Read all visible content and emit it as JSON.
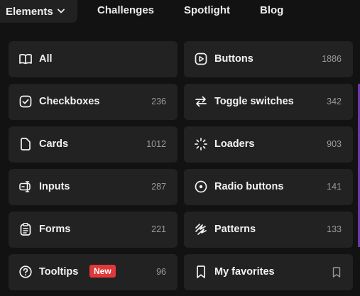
{
  "nav": {
    "elements_label": "Elements",
    "challenges_label": "Challenges",
    "spotlight_label": "Spotlight",
    "blog_label": "Blog"
  },
  "categories": [
    {
      "label": "All",
      "count": "",
      "icon": "book-open-icon"
    },
    {
      "label": "Buttons",
      "count": "1886",
      "icon": "play-button-icon"
    },
    {
      "label": "Checkboxes",
      "count": "236",
      "icon": "checkbox-icon"
    },
    {
      "label": "Toggle switches",
      "count": "342",
      "icon": "arrows-swap-icon"
    },
    {
      "label": "Cards",
      "count": "1012",
      "icon": "card-file-icon"
    },
    {
      "label": "Loaders",
      "count": "903",
      "icon": "loader-icon"
    },
    {
      "label": "Inputs",
      "count": "287",
      "icon": "input-icon"
    },
    {
      "label": "Radio buttons",
      "count": "141",
      "icon": "radio-icon"
    },
    {
      "label": "Forms",
      "count": "221",
      "icon": "clipboard-form-icon"
    },
    {
      "label": "Patterns",
      "count": "133",
      "icon": "pattern-icon"
    },
    {
      "label": "Tooltips",
      "count": "96",
      "icon": "help-circle-icon",
      "badge": "New"
    },
    {
      "label": "My favorites",
      "count": "",
      "icon": "bookmark-icon"
    }
  ],
  "colors": {
    "background": "#121212",
    "card": "#222222",
    "badge": "#e0393b",
    "count_text": "#9a9a9a",
    "label_text": "#f2f2f2",
    "edge_accent": "#6b3aa6"
  }
}
